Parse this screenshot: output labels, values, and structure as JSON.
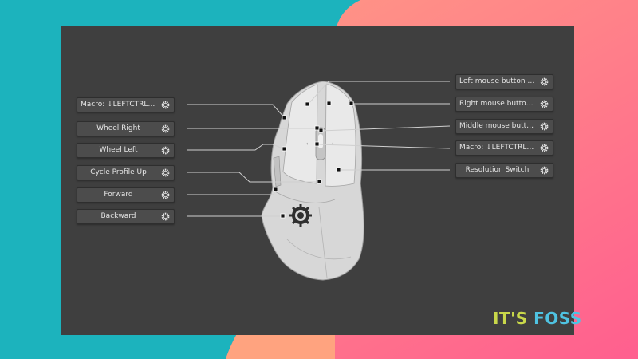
{
  "colors": {
    "teal": "#1cb3bd",
    "pink": "#ff6f8e",
    "peach": "#ffa37f",
    "panel": "#3f3f3f",
    "button": "#4c4c4c",
    "mouse_body": "#d6d6d6",
    "logo_green": "#c9d84a",
    "logo_blue": "#4fc3e2"
  },
  "left_bindings": [
    {
      "label": "Macro: ↓LEFTCTRL ↓...",
      "icon": "gear-icon"
    },
    {
      "label": "Wheel Right",
      "icon": "gear-icon"
    },
    {
      "label": "Wheel Left",
      "icon": "gear-icon"
    },
    {
      "label": "Cycle Profile Up",
      "icon": "gear-icon"
    },
    {
      "label": "Forward",
      "icon": "gear-icon"
    },
    {
      "label": "Backward",
      "icon": "gear-icon"
    }
  ],
  "right_bindings": [
    {
      "label": "Left mouse button cli...",
      "icon": "gear-icon"
    },
    {
      "label": "Right mouse button ...",
      "icon": "gear-icon"
    },
    {
      "label": "Middle mouse butto...",
      "icon": "gear-icon"
    },
    {
      "label": "Macro: ↓LEFTCTRL ↓...",
      "icon": "gear-icon"
    },
    {
      "label": "Resolution Switch",
      "icon": "gear-icon"
    }
  ],
  "logo": {
    "part1": "IT'S",
    "part2": "FOSS"
  }
}
